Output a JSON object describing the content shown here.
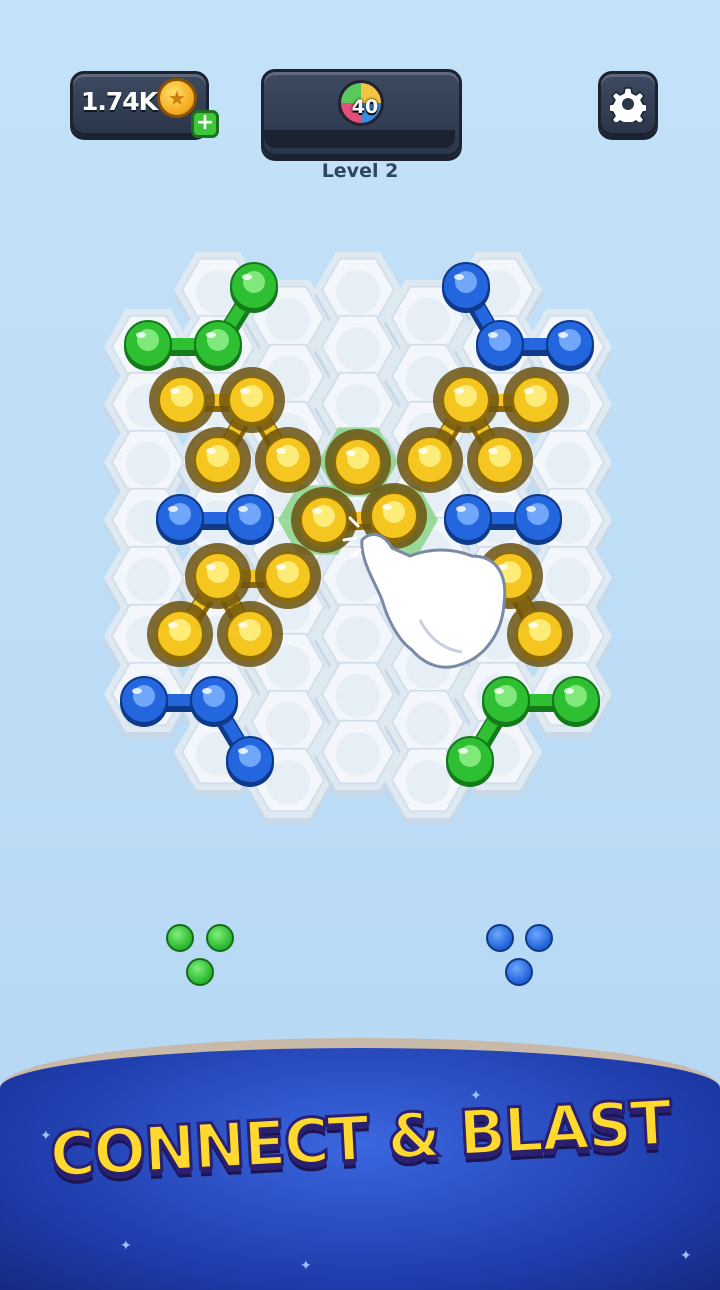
{
  "hud": {
    "coins": "1.74K",
    "add_coins_symbol": "+",
    "moves_remaining": "40",
    "level_label": "Level 2",
    "level_progress": 0
  },
  "icons": {
    "coin": "coin-icon",
    "add": "plus-icon",
    "settings": "gear-icon",
    "moves": "moves-orb-icon",
    "hand": "pointing-hand-icon"
  },
  "colors": {
    "green": "#2fbf33",
    "blue": "#2366dd",
    "yellow": "#f5c620",
    "tile": "#f3f7fb",
    "board_rim": "#dfe9f2"
  },
  "tray": {
    "left_piece_color": "green",
    "right_piece_color": "blue"
  },
  "banner": {
    "title": "CONNECT & BLAST"
  }
}
